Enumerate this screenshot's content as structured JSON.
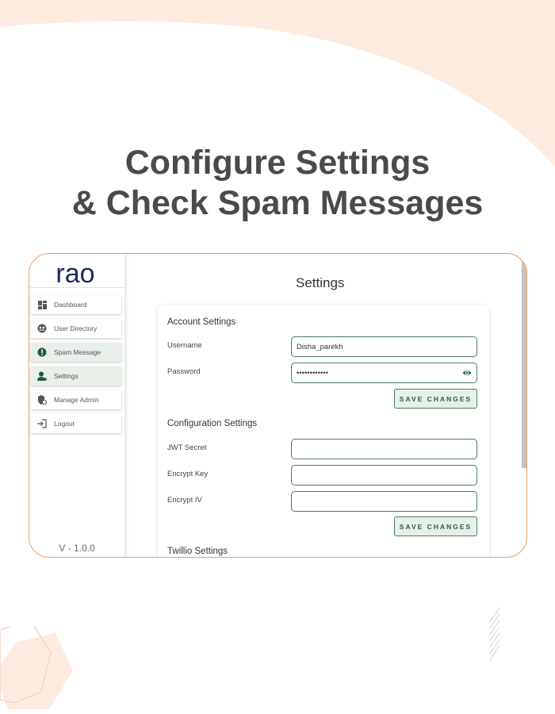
{
  "colors": {
    "peach_background": "#fdebdf",
    "frame_border": "#f09a56",
    "accent_green": "#1e5a3a",
    "headline_text": "#4a4a4a"
  },
  "headline": {
    "line1": "Configure Settings",
    "line2": "& Check Spam Messages"
  },
  "app": {
    "logo_text": "rao",
    "version": "V - 1.0.0",
    "sidebar": {
      "items": [
        {
          "label": "Dashboard",
          "icon": "dashboard-icon",
          "active": false
        },
        {
          "label": "User Directory",
          "icon": "user-directory-icon",
          "active": false
        },
        {
          "label": "Spam Message",
          "icon": "alert-icon",
          "active": true
        },
        {
          "label": "Settings",
          "icon": "settings-user-icon",
          "active": true
        },
        {
          "label": "Manage Admin",
          "icon": "manage-admin-icon",
          "active": false
        },
        {
          "label": "Logout",
          "icon": "logout-icon",
          "active": false
        }
      ]
    },
    "page_title": "Settings",
    "account_settings": {
      "title": "Account Settings",
      "username_label": "Username",
      "username_value": "Disha_parekh",
      "password_label": "Password",
      "password_value": "••••••••••••",
      "password_icon": "eye-icon",
      "save_label": "SAVE CHANGES"
    },
    "configuration_settings": {
      "title": "Configuration Settings",
      "jwt_label": "JWT Secret",
      "jwt_value": "",
      "encrypt_key_label": "Encrypt Key",
      "encrypt_key_value": "",
      "encrypt_iv_label": "Encrypt IV",
      "encrypt_iv_value": "",
      "save_label": "SAVE CHANGES"
    },
    "twillio_settings": {
      "title": "Twillio Settings"
    }
  }
}
